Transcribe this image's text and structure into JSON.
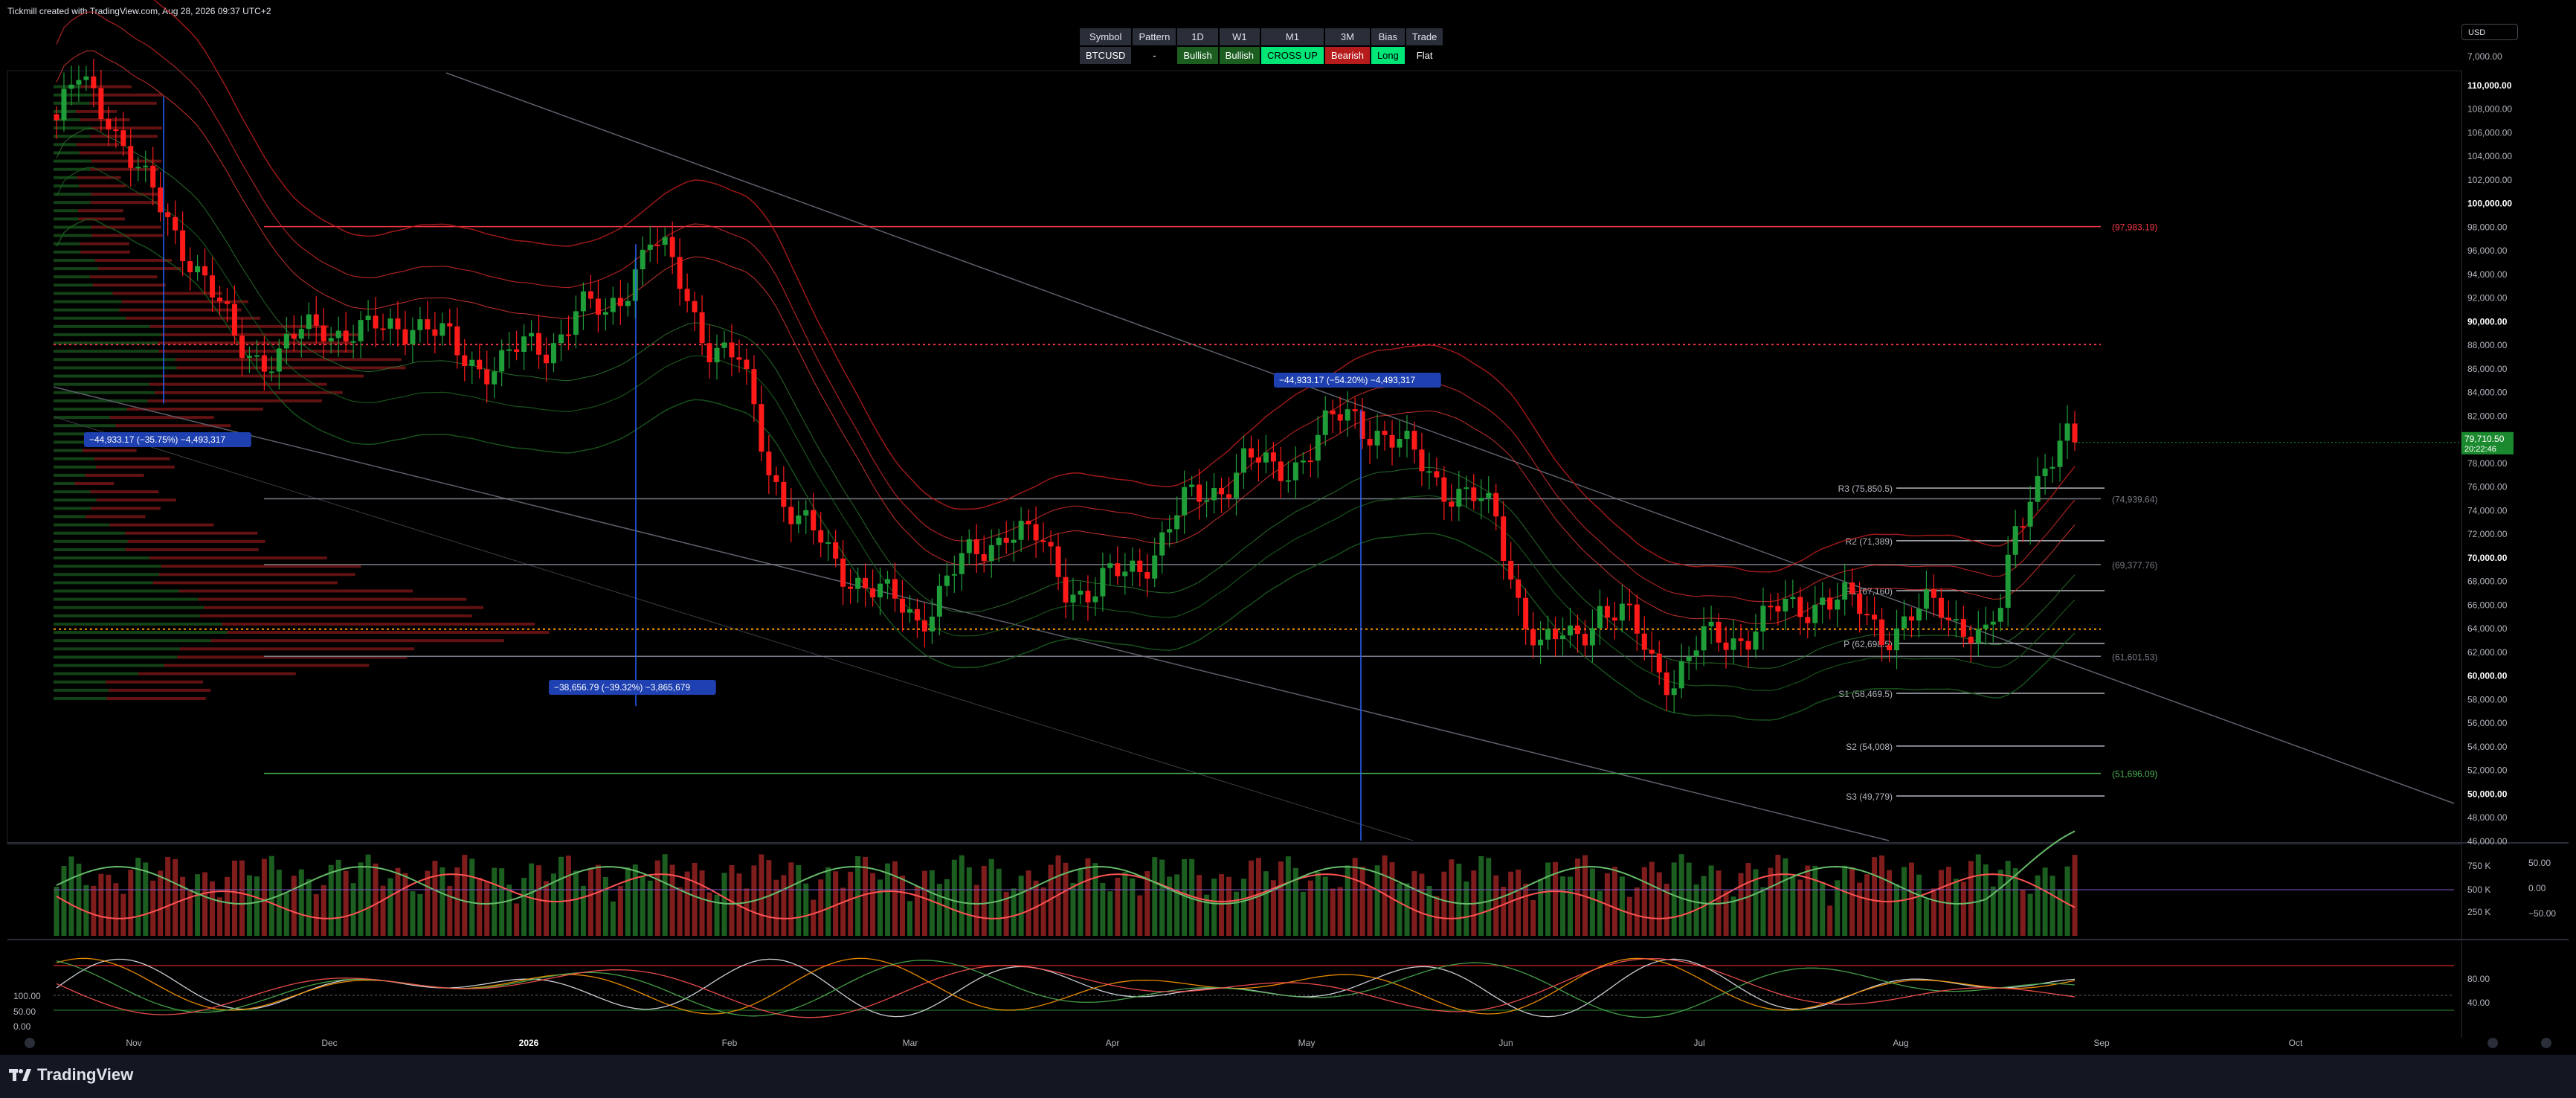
{
  "header": {
    "credit": "Tickmill created with TradingView.com, Aug 28, 2026 09:37 UTC+2"
  },
  "currency_button": "USD",
  "signal_table": {
    "headers": [
      "Symbol",
      "Pattern",
      "1D",
      "W1",
      "M1",
      "3M",
      "Bias",
      "Trade"
    ],
    "values": [
      "BTCUSD",
      "-",
      "Bullish",
      "Bullish",
      "CROSS UP",
      "Bearish",
      "Long",
      "Flat"
    ],
    "value_colors": [
      "#2a2e39",
      "#000000",
      "#1b5e20",
      "#1b5e20",
      "#00e676",
      "#b71c1c",
      "#00e676",
      "#000000"
    ]
  },
  "colors": {
    "up": "#1f9d39",
    "down": "#ff1a1a",
    "accent_blue": "#2962ff",
    "green_level": "#4caf50",
    "red_level": "#f23645"
  },
  "footer": {
    "brand": "TradingView"
  },
  "chart_data": {
    "type": "candlestick",
    "symbol": "BTCUSD",
    "ylim": [
      46000,
      111000
    ],
    "price_axis_labels": [
      "110,000.00",
      "108,000.00",
      "106,000.00",
      "104,000.00",
      "102,000.00",
      "100,000.00",
      "98,000.00",
      "96,000.00",
      "94,000.00",
      "92,000.00",
      "90,000.00",
      "88,000.00",
      "86,000.00",
      "84,000.00",
      "82,000.00",
      "80,000.00",
      "78,000.00",
      "76,000.00",
      "74,000.00",
      "72,000.00",
      "70,000.00",
      "68,000.00",
      "66,000.00",
      "64,000.00",
      "62,000.00",
      "60,000.00",
      "58,000.00",
      "56,000.00",
      "54,000.00",
      "52,000.00",
      "50,000.00",
      "48,000.00",
      "46,000.00"
    ],
    "price_axis_top": "7,000.00",
    "x_axis_labels": [
      "Nov",
      "Dec",
      "2026",
      "Feb",
      "Mar",
      "Apr",
      "May",
      "Jun",
      "Jul",
      "Aug",
      "Sep",
      "Oct"
    ],
    "current_price": {
      "price": "79,710.50",
      "countdown": "20:22:46",
      "value": 79710.5
    },
    "close_anchors": [
      {
        "t": 0,
        "v": 107000
      },
      {
        "t": 3,
        "v": 110000
      },
      {
        "t": 7,
        "v": 108000
      },
      {
        "t": 12,
        "v": 101000
      },
      {
        "t": 18,
        "v": 96000
      },
      {
        "t": 24,
        "v": 88000
      },
      {
        "t": 30,
        "v": 87000
      },
      {
        "t": 36,
        "v": 90000
      },
      {
        "t": 42,
        "v": 88500
      },
      {
        "t": 48,
        "v": 90500
      },
      {
        "t": 54,
        "v": 87000
      },
      {
        "t": 60,
        "v": 86500
      },
      {
        "t": 66,
        "v": 88000
      },
      {
        "t": 70,
        "v": 91000
      },
      {
        "t": 74,
        "v": 90000
      },
      {
        "t": 78,
        "v": 95000
      },
      {
        "t": 80,
        "v": 97000
      },
      {
        "t": 84,
        "v": 93000
      },
      {
        "t": 88,
        "v": 88500
      },
      {
        "t": 92,
        "v": 86000
      },
      {
        "t": 96,
        "v": 78000
      },
      {
        "t": 100,
        "v": 73000
      },
      {
        "t": 104,
        "v": 70000
      },
      {
        "t": 108,
        "v": 68500
      },
      {
        "t": 112,
        "v": 66000
      },
      {
        "t": 116,
        "v": 65000
      },
      {
        "t": 120,
        "v": 68000
      },
      {
        "t": 124,
        "v": 70000
      },
      {
        "t": 128,
        "v": 73000
      },
      {
        "t": 132,
        "v": 71000
      },
      {
        "t": 136,
        "v": 68000
      },
      {
        "t": 140,
        "v": 67000
      },
      {
        "t": 144,
        "v": 68500
      },
      {
        "t": 148,
        "v": 71000
      },
      {
        "t": 152,
        "v": 74000
      },
      {
        "t": 156,
        "v": 76000
      },
      {
        "t": 160,
        "v": 78000
      },
      {
        "t": 164,
        "v": 77000
      },
      {
        "t": 168,
        "v": 79000
      },
      {
        "t": 172,
        "v": 81000
      },
      {
        "t": 175,
        "v": 82000
      },
      {
        "t": 178,
        "v": 81000
      },
      {
        "t": 182,
        "v": 78500
      },
      {
        "t": 186,
        "v": 77000
      },
      {
        "t": 190,
        "v": 75000
      },
      {
        "t": 194,
        "v": 73000
      },
      {
        "t": 197,
        "v": 67000
      },
      {
        "t": 200,
        "v": 62000
      },
      {
        "t": 204,
        "v": 63000
      },
      {
        "t": 208,
        "v": 66000
      },
      {
        "t": 212,
        "v": 64000
      },
      {
        "t": 215,
        "v": 61500
      },
      {
        "t": 218,
        "v": 60000
      },
      {
        "t": 222,
        "v": 62500
      },
      {
        "t": 226,
        "v": 63500
      },
      {
        "t": 230,
        "v": 64500
      },
      {
        "t": 234,
        "v": 65500
      },
      {
        "t": 238,
        "v": 67000
      },
      {
        "t": 242,
        "v": 65500
      },
      {
        "t": 246,
        "v": 64000
      },
      {
        "t": 250,
        "v": 64800
      },
      {
        "t": 254,
        "v": 65500
      },
      {
        "t": 258,
        "v": 64500
      },
      {
        "t": 260,
        "v": 63000
      },
      {
        "t": 262,
        "v": 65000
      },
      {
        "t": 264,
        "v": 72000
      },
      {
        "t": 266,
        "v": 76000
      },
      {
        "t": 268,
        "v": 78500
      },
      {
        "t": 270,
        "v": 79000
      },
      {
        "t": 272,
        "v": 79710
      }
    ],
    "horizontal_levels": [
      {
        "price": 97983.19,
        "label": "(97,983.19)",
        "color": "#f23645"
      },
      {
        "price": 88000,
        "label": "",
        "color": "#f23645",
        "dotted": true
      },
      {
        "price": 75850.5,
        "label": "R3 (75,850.5)",
        "color": "#b2b5be"
      },
      {
        "price": 74939.64,
        "label": "(74,939.64)",
        "color": "#787b86"
      },
      {
        "price": 71389,
        "label": "R2 (71,389)",
        "color": "#b2b5be"
      },
      {
        "price": 69377.76,
        "label": "(69,377.76)",
        "color": "#787b86"
      },
      {
        "price": 67160,
        "label": "R1 (67,160)",
        "color": "#b2b5be"
      },
      {
        "price": 63900,
        "label": "",
        "color": "#ff9800",
        "dotted": true
      },
      {
        "price": 62698,
        "label": "P (62,698.5)",
        "color": "#b2b5be"
      },
      {
        "price": 61601.53,
        "label": "(61,601.53)",
        "color": "#787b86"
      },
      {
        "price": 58469.5,
        "label": "S1 (58,469.5)",
        "color": "#b2b5be"
      },
      {
        "price": 54008,
        "label": "S2 (54,008)",
        "color": "#b2b5be"
      },
      {
        "price": 51696.09,
        "label": "(51,696.09)",
        "color": "#4caf50"
      },
      {
        "price": 49779,
        "label": "S3 (49,779)",
        "color": "#b2b5be"
      }
    ],
    "measure_labels": [
      {
        "text": "−44,933.17 (−35.75%) −4,493,317"
      },
      {
        "text": "−38,656.79 (−39.32%) −3,865,679"
      },
      {
        "text": "−44,933.17 (−54.20%) −4,493,317"
      }
    ],
    "volume_axis_labels": [
      "750 K",
      "500 K",
      "250 K"
    ],
    "volume_right_labels": [
      "50.00",
      "0.00",
      "−50.00"
    ],
    "oscillator_left_labels": [
      "100.00",
      "50.00",
      "0.00"
    ],
    "oscillator_right_labels": [
      "80.00",
      "40.00"
    ]
  }
}
